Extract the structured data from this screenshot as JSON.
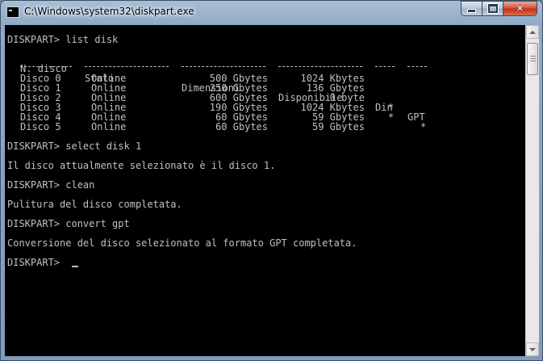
{
  "window": {
    "title": "C:\\Windows\\system32\\diskpart.exe",
    "icon": "console-icon",
    "controls": {
      "minimize": "minimize-icon",
      "maximize": "maximize-icon",
      "close": "✕"
    }
  },
  "console": {
    "colors": {
      "background": "#000000",
      "text": "#c0c0c0"
    },
    "cmd_list": "DISKPART> list disk",
    "headers": {
      "n": "N. disco",
      "stato": "Stato",
      "dim": "Dimensioni",
      "disp": "Disponibile",
      "din": "Din",
      "gpt": "GPT"
    },
    "disks": [
      {
        "n": "Disco 0",
        "stato": "Online",
        "dim": "500 Gbytes",
        "disp": "1024 Kbytes",
        "din": "",
        "gpt": ""
      },
      {
        "n": "Disco 1",
        "stato": "Online",
        "dim": "250 Gbytes",
        "disp": "136 Gbytes",
        "din": "",
        "gpt": ""
      },
      {
        "n": "Disco 2",
        "stato": "Online",
        "dim": "600 Gbytes",
        "disp": "0 byte",
        "din": "",
        "gpt": ""
      },
      {
        "n": "Disco 3",
        "stato": "Online",
        "dim": "190 Gbytes",
        "disp": "1024 Kbytes",
        "din": "*",
        "gpt": ""
      },
      {
        "n": "Disco 4",
        "stato": "Online",
        "dim": "60 Gbytes",
        "disp": "59 Gbytes",
        "din": "*",
        "gpt": ""
      },
      {
        "n": "Disco 5",
        "stato": "Online",
        "dim": "60 Gbytes",
        "disp": "59 Gbytes",
        "din": "",
        "gpt": "*"
      }
    ],
    "cmd_select": "DISKPART> select disk 1",
    "out_select": "Il disco attualmente selezionato è il disco 1.",
    "cmd_clean": "DISKPART> clean",
    "out_clean": "Pulitura del disco completata.",
    "cmd_convert": "DISKPART> convert gpt",
    "out_convert": "Conversione del disco selezionato al formato GPT completata.",
    "prompt": "DISKPART> "
  },
  "scrollbar": {
    "up": "scroll-up-icon",
    "down": "scroll-down-icon"
  }
}
